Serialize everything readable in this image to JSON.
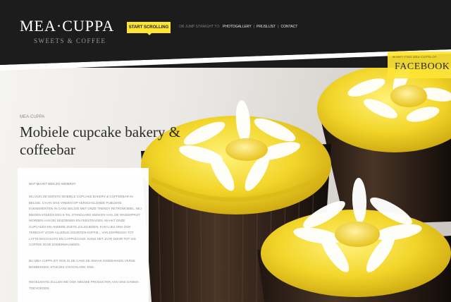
{
  "header": {
    "logo": "MEA·CUPPA",
    "logo_sub": "SWEETS & COFFEE",
    "start_button": "START SCROLLING",
    "nav_intro": "OR JUMP STRAIGHT TO:",
    "nav": [
      "PHOTOGALLERY",
      "PRIJSLIJST",
      "CONTACT"
    ]
  },
  "facebook": {
    "small": "MORE? FIND MEA·CUPPA OP",
    "big": "FACEBOOK"
  },
  "intro": {
    "kicker": "MEA·CUPPA",
    "headline": "Mobiele cupcake bakery & coffeebar"
  },
  "panel": {
    "question": "WAT MAAKT EEN ZO ANDERS?",
    "p1": "WIJ ZIJN DE EERSTE MOBIELE CUPCAKE BAKERY & COFFEEBAR IN BELGIE. U KAN ONS VINDEN OP VERSCHILLENDE PUBLIEKE EVENEMENTEN IN GANS BELGIE MET ONZE TRENDY RETROMOBIEL. WIJ BIEDEN STEEDS EEN 6-TAL STANDAARD SMAKEN AAN, DE WAGENPRIJT WORDEN AAN DE SEIZOENEN EN FEESTDAGEN. MAAKT ONZE CUPCAKES EN ANDERE ZOETE ZALIGHEDEN, KAN U BIJ ONS OOK TERECHT VOOR ALLERLEI SOORTEN KOFFIE... VAN ESPRESSO TOT LATTE MACCHIATO EN CAPPUCCINO, GANS HET JAAR DOOR TOT ICE COFFEE IN DE ZOMERMAANDEN.",
    "p2": "BIJ MEA CUPPA ZIT OOK IN DE CAKE DE SMAAK INGEBAKKEN VERSE BOSBESSEN, STUKJES CHOCOLADE, ENZ.",
    "p3": "REGELMATIG ZULLEN WE OOK NIEUWE PRODUCTEN AAN ONS GAMMA TOEVOEGEN."
  },
  "colors": {
    "accent": "#ffe533",
    "header_bg": "#1c1c1c",
    "frosting": "#f3d62a",
    "wrapper": "#3a2a1e"
  }
}
